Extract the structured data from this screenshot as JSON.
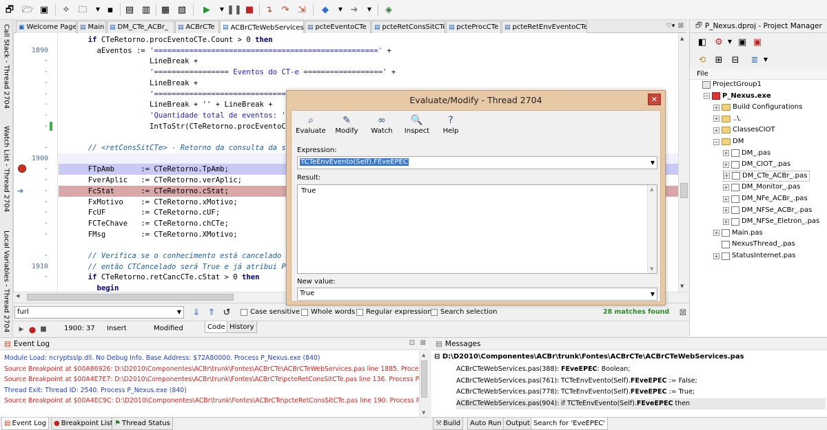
{
  "toolbar": {
    "icons": [
      "new-project",
      "open",
      "save-all",
      "new-file",
      "open-file",
      "save",
      "close",
      "save-file",
      "open-project",
      "save-project",
      "run",
      "run-dropdown",
      "pause",
      "stop",
      "step-into",
      "step-over",
      "trace",
      "back",
      "back-dropdown",
      "forward",
      "forward-dropdown",
      "help-book"
    ]
  },
  "left_panels": [
    "Call Stack - Thread 2704",
    "Watch List - Thread 2704",
    "Local Variables - Thread 2704"
  ],
  "tabs": [
    {
      "label": "Welcome Page",
      "active": false
    },
    {
      "label": "Main",
      "active": false
    },
    {
      "label": "DM_CTe_ACBr_",
      "active": false
    },
    {
      "label": "ACBrCTe",
      "active": false
    },
    {
      "label": "ACBrCTeWebServices",
      "active": true
    },
    {
      "label": "pcteEventoCTe",
      "active": false
    },
    {
      "label": "pcteRetConsSitCTe",
      "active": false
    },
    {
      "label": "pcteProcCTe",
      "active": false
    },
    {
      "label": "pcteRetEnvEventoCTe",
      "active": false
    }
  ],
  "editor": {
    "lines": [
      {
        "num": "",
        "mark": "",
        "code": [
          {
            "t": "  "
          },
          {
            "t": "if",
            "c": "kw"
          },
          {
            "t": " CTeRetorno.procEventoCTe.Count > 0 "
          },
          {
            "t": "then",
            "c": "kw"
          }
        ]
      },
      {
        "num": "1890",
        "mark": "",
        "code": [
          {
            "t": "    aEventos := "
          },
          {
            "t": "'==================================================='",
            "c": "str"
          },
          {
            "t": " +"
          }
        ]
      },
      {
        "num": "-",
        "mark": "",
        "code": [
          {
            "t": "                LineBreak +"
          }
        ]
      },
      {
        "num": "-",
        "mark": "",
        "code": [
          {
            "t": "                "
          },
          {
            "t": "'================= Eventos do CT-e =================='",
            "c": "str"
          },
          {
            "t": " +"
          }
        ]
      },
      {
        "num": "-",
        "mark": "",
        "code": [
          {
            "t": "                LineBreak +"
          }
        ]
      },
      {
        "num": "-",
        "mark": "",
        "code": [
          {
            "t": "                "
          },
          {
            "t": "'==================================================='",
            "c": "str"
          },
          {
            "t": " +"
          }
        ]
      },
      {
        "num": "-",
        "mark": "",
        "code": [
          {
            "t": "                LineBreak + '' + LineBreak +"
          }
        ]
      },
      {
        "num": "-",
        "mark": "",
        "code": [
          {
            "t": "                "
          },
          {
            "t": "'Quantidade total de eventos: '",
            "c": "str"
          },
          {
            "t": " +"
          }
        ]
      },
      {
        "num": "-",
        "mark": "",
        "code": [
          {
            "t": "                IntToStr(CTeRetorno.procEventoCTe.Count);"
          }
        ]
      },
      {
        "num": "",
        "mark": "",
        "code": [
          {
            "t": ""
          }
        ]
      },
      {
        "num": "-",
        "mark": "",
        "code": [
          {
            "t": "  "
          },
          {
            "t": "// <retConsSitCTe> - Retorno da consulta da situação do CT-e",
            "c": "cm"
          }
        ]
      },
      {
        "num": "1900",
        "mark": "",
        "code": [
          {
            "t": ""
          }
        ]
      },
      {
        "num": "-",
        "mark": "bp",
        "code": [
          {
            "t": "  FTpAmb      := CTeRetorno.TpAmb;"
          }
        ]
      },
      {
        "num": "-",
        "mark": "",
        "code": [
          {
            "t": "  FverAplic   := CTeRetorno.verAplic;"
          }
        ]
      },
      {
        "num": "-",
        "mark": "exec",
        "code": [
          {
            "t": "  FcStat      := CTeRetorno.cStat;"
          }
        ]
      },
      {
        "num": "-",
        "mark": "",
        "code": [
          {
            "t": "  FxMotivo    := CTeRetorno.xMotivo;"
          }
        ]
      },
      {
        "num": "-",
        "mark": "",
        "code": [
          {
            "t": "  FcUF        := CTeRetorno.cUF;"
          }
        ]
      },
      {
        "num": "-",
        "mark": "",
        "code": [
          {
            "t": "  FCTeChave   := CTeRetorno.chCTe;"
          }
        ]
      },
      {
        "num": "-",
        "mark": "",
        "code": [
          {
            "t": "  FMsg        := CTeRetorno.XMotivo;"
          }
        ]
      },
      {
        "num": "",
        "mark": "",
        "code": [
          {
            "t": ""
          }
        ]
      },
      {
        "num": "-",
        "mark": "",
        "code": [
          {
            "t": "  "
          },
          {
            "t": "// Verifica se o conhecimento está cancelado pela SEFAZ",
            "c": "cm"
          }
        ]
      },
      {
        "num": "1910",
        "mark": "",
        "code": [
          {
            "t": "  "
          },
          {
            "t": "// então CTCancelado será True e já atribui Protocolo",
            "c": "cm"
          }
        ]
      },
      {
        "num": "-",
        "mark": "",
        "code": [
          {
            "t": "  "
          },
          {
            "t": "if",
            "c": "kw"
          },
          {
            "t": " CTeRetorno.retCancCTe.cStat > 0 "
          },
          {
            "t": "then",
            "c": "kw"
          }
        ]
      },
      {
        "num": "",
        "mark": "",
        "code": [
          {
            "t": "    "
          },
          {
            "t": "begin",
            "c": "kw"
          }
        ]
      }
    ]
  },
  "search": {
    "value": "furl",
    "case_sensitive": "Case sensitive",
    "whole_words": "Whole words",
    "regex": "Regular expression",
    "selection": "Search selection",
    "matches": "28 matches found"
  },
  "status": {
    "position": "1900: 37",
    "mode": "Insert",
    "state": "Modified",
    "tab_code": "Code",
    "tab_history": "History"
  },
  "project_manager": {
    "title": "P_Nexus.dproj - Project Manager",
    "file_label": "File",
    "tree": [
      {
        "label": "ProjectGroup1",
        "level": 0,
        "kind": "group",
        "bold": false,
        "exp": ""
      },
      {
        "label": "P_Nexus.exe",
        "level": 1,
        "kind": "exe",
        "bold": true,
        "exp": "−"
      },
      {
        "label": "Build Configurations",
        "level": 2,
        "kind": "folder",
        "bold": false,
        "exp": "+"
      },
      {
        "label": "..\\.",
        "level": 2,
        "kind": "folder",
        "bold": false,
        "exp": "+"
      },
      {
        "label": "ClassesCIOT",
        "level": 2,
        "kind": "folder",
        "bold": false,
        "exp": "+"
      },
      {
        "label": "DM",
        "level": 2,
        "kind": "folder",
        "bold": false,
        "exp": "−"
      },
      {
        "label": "DM_.pas",
        "level": 3,
        "kind": "file",
        "bold": false,
        "exp": "+"
      },
      {
        "label": "DM_CIOT_.pas",
        "level": 3,
        "kind": "file",
        "bold": false,
        "exp": "+"
      },
      {
        "label": "DM_CTe_ACBr_.pas",
        "level": 3,
        "kind": "file",
        "bold": false,
        "exp": "+"
      },
      {
        "label": "DM_Monitor_.pas",
        "level": 3,
        "kind": "file",
        "bold": false,
        "exp": "+"
      },
      {
        "label": "DM_NFe_ACBr_.pas",
        "level": 3,
        "kind": "file",
        "bold": false,
        "exp": "+"
      },
      {
        "label": "DM_NFSe_ACBr_.pas",
        "level": 3,
        "kind": "file",
        "bold": false,
        "exp": "+"
      },
      {
        "label": "DM_NFSe_Eletron_.pas",
        "level": 3,
        "kind": "file",
        "bold": false,
        "exp": "+"
      },
      {
        "label": "Main.pas",
        "level": 2,
        "kind": "file",
        "bold": false,
        "exp": "+"
      },
      {
        "label": "NexusThread_.pas",
        "level": 2,
        "kind": "file",
        "bold": false,
        "exp": ""
      },
      {
        "label": "StatusInternet.pas",
        "level": 2,
        "kind": "file",
        "bold": false,
        "exp": "+"
      }
    ]
  },
  "dialog": {
    "title": "Evaluate/Modify - Thread 2704",
    "close": "✕",
    "buttons": [
      "Evaluate",
      "Modify",
      "Watch",
      "Inspect",
      "Help"
    ],
    "expression_label": "Expression:",
    "expression_value": "TCTeEnvEvento(Self).FEveEPEC",
    "result_label": "Result:",
    "result_value": "True",
    "newvalue_label": "New value:",
    "newvalue_value": "True"
  },
  "event_log": {
    "title": "Event Log",
    "lines": [
      {
        "text": "Module Load: ncryptsslp.dll. No Debug Info. Base Address: $72A80000. Process P_Nexus.exe (840)",
        "color": "blue"
      },
      {
        "text": "Source Breakpoint at $00A86926: D:\\D2010\\Componentes\\ACBr\\trunk\\Fontes\\ACBrCTe\\ACBrCTeWebServices.pas line 1885. Process P_Ne",
        "color": "red"
      },
      {
        "text": "Source Breakpoint at $00A4E7E7: D:\\D2010\\Componentes\\ACBr\\trunk\\Fontes\\ACBrCTe\\pcteRetConsSitCTe.pas line 136. Process P_Ne",
        "color": "red"
      },
      {
        "text": "Thread Exit: Thread ID: 2540. Process P_Nexus.exe (840)",
        "color": "blue"
      },
      {
        "text": "Source Breakpoint at $00A4EC9C: D:\\D2010\\Componentes\\ACBr\\trunk\\Fontes\\ACBrCTe\\pcteRetConsSitCTe.pas line 190. Process P_Ne",
        "color": "red"
      }
    ],
    "tabs": [
      "Event Log",
      "Breakpoint List",
      "Thread Status"
    ]
  },
  "messages": {
    "title": "Messages",
    "path": "D:\\D2010\\Componentes\\ACBr\\trunk\\Fontes\\ACBrCTe\\ACBrCTeWebServices.pas",
    "lines": [
      {
        "loc": "ACBrCTeWebServices.pas(388):",
        "code": [
          {
            "t": "FEveEPEC",
            "b": true
          },
          {
            "t": ": Boolean;"
          }
        ]
      },
      {
        "loc": "ACBrCTeWebServices.pas(761):",
        "code": [
          {
            "t": "TCTeEnvEvento(Self)."
          },
          {
            "t": "FEveEPEC",
            "b": true
          },
          {
            "t": " := False;"
          }
        ]
      },
      {
        "loc": "ACBrCTeWebServices.pas(778):",
        "code": [
          {
            "t": "TCTeEnvEvento(Self)."
          },
          {
            "t": "FEveEPEC",
            "b": true
          },
          {
            "t": " := True;"
          }
        ]
      },
      {
        "loc": "ACBrCTeWebServices.pas(904):",
        "code": [
          {
            "t": "if TCTeEnvEvento(Self)."
          },
          {
            "t": "FEveEPEC",
            "b": true
          },
          {
            "t": " then"
          }
        ]
      }
    ],
    "tabs": [
      "Build",
      "Auto Run",
      "Output",
      "Search for 'EveEPEC'"
    ]
  }
}
